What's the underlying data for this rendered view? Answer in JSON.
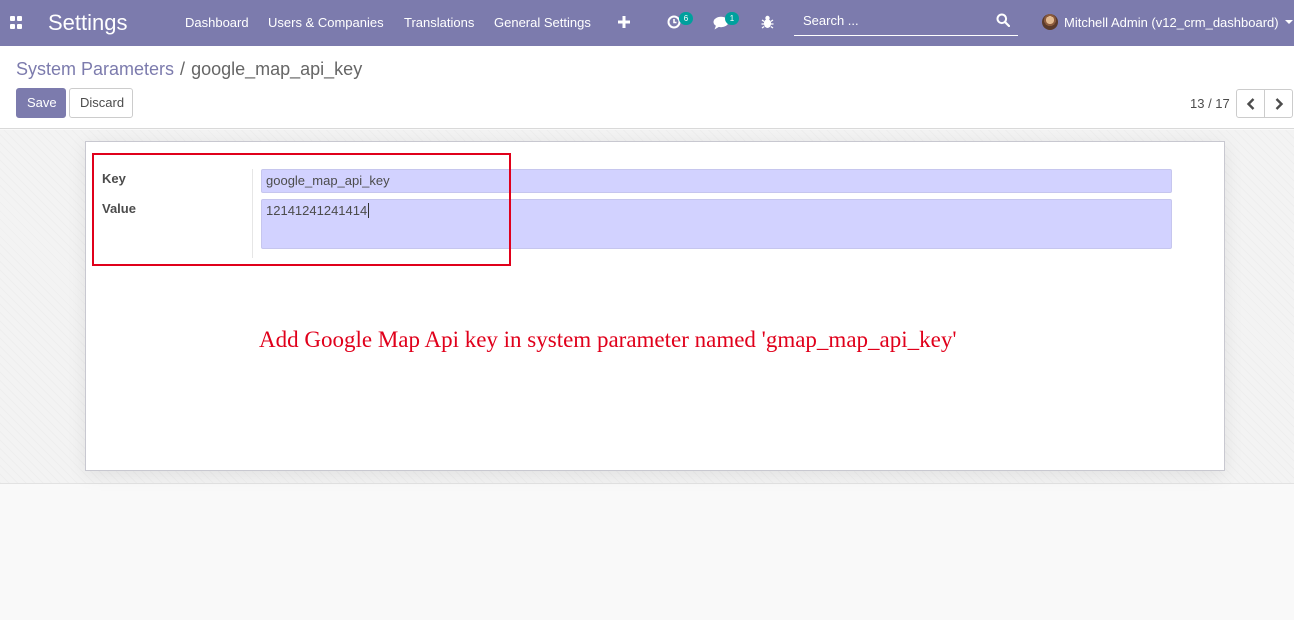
{
  "app": {
    "title": "Settings"
  },
  "navbar": {
    "menu": [
      {
        "label": "Dashboard"
      },
      {
        "label": "Users & Companies"
      },
      {
        "label": "Translations"
      },
      {
        "label": "General Settings"
      }
    ],
    "icons": {
      "apps": "apps-grid-icon",
      "quick_create": "plus-icon",
      "activities": "clock-icon",
      "messages": "chat-bubble-icon",
      "debug": "bug-icon"
    },
    "activities_badge": "6",
    "messages_badge": "1",
    "search": {
      "placeholder": "Search ..."
    },
    "user": {
      "name": "Mitchell Admin (v12_crm_dashboard)"
    }
  },
  "control_panel": {
    "breadcrumb": {
      "parent": "System Parameters",
      "separator": "/",
      "current": "google_map_api_key"
    },
    "buttons": {
      "save": "Save",
      "discard": "Discard"
    },
    "pager": {
      "value": "13 / 17"
    }
  },
  "form": {
    "key_label": "Key",
    "key_value": "google_map_api_key",
    "value_label": "Value",
    "value_value": "12141241241414"
  },
  "annotation": {
    "text": "Add Google Map Api key in system parameter named 'gmap_map_api_key'"
  },
  "colors": {
    "brand": "#7c7bad",
    "badge": "#00a09d",
    "required_field": "#d2d2ff",
    "annotation": "#e0001b"
  }
}
